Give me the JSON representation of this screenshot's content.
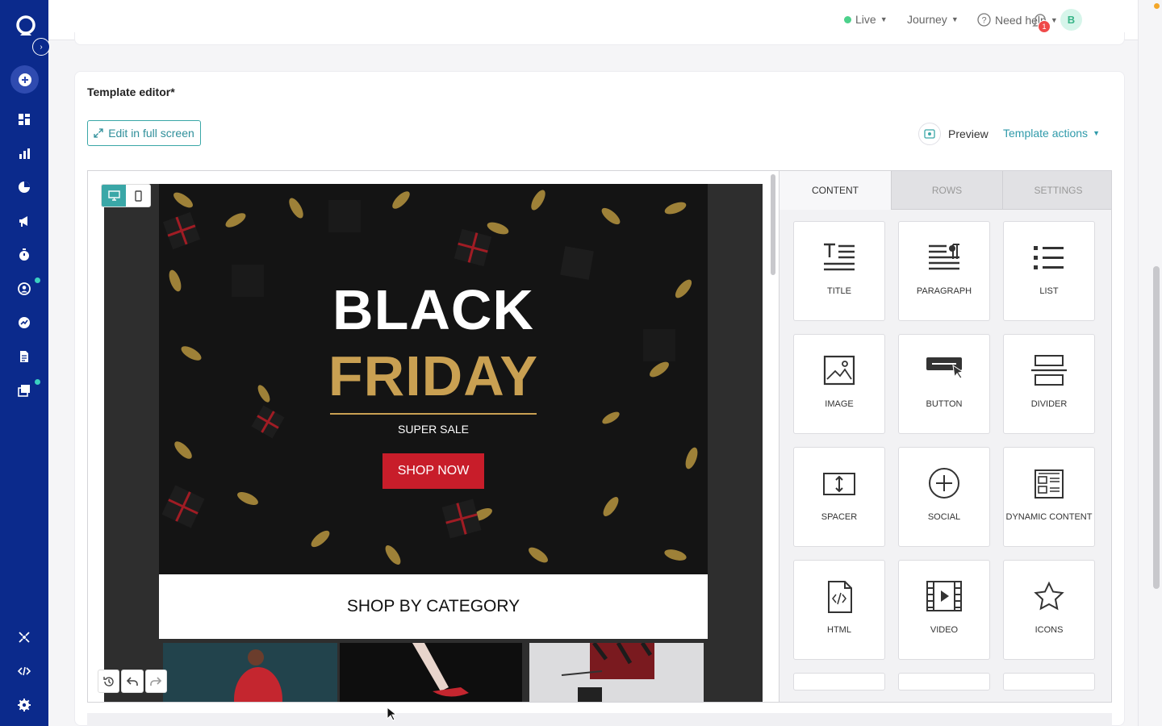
{
  "topbar": {
    "live_label": "Live",
    "journey_label": "Journey",
    "help_label": "Need help",
    "notification_count": "1",
    "avatar_initial": "B"
  },
  "sidebar": {
    "items": [
      {
        "icon": "dashboard-icon"
      },
      {
        "icon": "bar-chart-icon"
      },
      {
        "icon": "pie-chart-icon"
      },
      {
        "icon": "megaphone-icon"
      },
      {
        "icon": "timer-icon"
      },
      {
        "icon": "contacts-icon"
      },
      {
        "icon": "analytics-icon"
      },
      {
        "icon": "document-icon"
      },
      {
        "icon": "templates-icon"
      },
      {
        "icon": "integrations-icon"
      },
      {
        "icon": "code-icon"
      },
      {
        "icon": "settings-icon"
      }
    ]
  },
  "editor": {
    "title": "Template editor*",
    "fullscreen_label": "Edit in full screen",
    "preview_label": "Preview",
    "template_actions_label": "Template actions"
  },
  "email": {
    "hero_line1": "BLACK",
    "hero_line2": "FRIDAY",
    "hero_subtitle": "SUPER SALE",
    "hero_button": "SHOP NOW",
    "category_heading": "SHOP BY CATEGORY"
  },
  "panel": {
    "tabs": [
      "CONTENT",
      "ROWS",
      "SETTINGS"
    ],
    "active_tab": "CONTENT",
    "blocks": [
      "TITLE",
      "PARAGRAPH",
      "LIST",
      "IMAGE",
      "BUTTON",
      "DIVIDER",
      "SPACER",
      "SOCIAL",
      "DYNAMIC CONTENT",
      "HTML",
      "VIDEO",
      "ICONS"
    ]
  },
  "colors": {
    "sidebar_bg": "#0b2a8c",
    "accent_teal": "#3aa7a7",
    "hero_gold": "#c9a052",
    "hero_red": "#c81d2a"
  }
}
